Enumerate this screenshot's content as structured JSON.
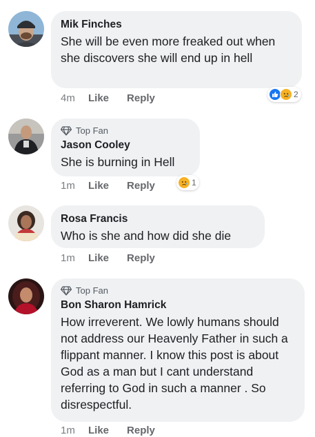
{
  "comments": [
    {
      "top_fan": "",
      "name": "Mik Finches",
      "text": "She will be even more freaked out when she discovers she will end up in hell",
      "time": "4m",
      "like": "Like",
      "reply": "Reply",
      "reaction_icons": [
        "like-reaction-icon",
        "sad-reaction-icon"
      ],
      "reaction_count": "2"
    },
    {
      "top_fan": "Top Fan",
      "name": "Jason Cooley",
      "text": "She is burning in Hell",
      "time": "1m",
      "like": "Like",
      "reply": "Reply",
      "reaction_icons": [
        "sad-reaction-icon"
      ],
      "reaction_count": "1"
    },
    {
      "top_fan": "",
      "name": "Rosa Francis",
      "text": "Who is she and how did she die",
      "time": "1m",
      "like": "Like",
      "reply": "Reply"
    },
    {
      "top_fan": "Top Fan",
      "name": "Bon Sharon Hamrick",
      "text": "How irreverent.  We lowly humans should not address our Heavenly Father in such a flippant manner. I know this post is about God as a man but I cant understand referring to God in such a manner . So disrespectful.",
      "time": "1m",
      "like": "Like",
      "reply": "Reply"
    }
  ],
  "colors": {
    "bubble": "#eff1f3",
    "meta_text": "#65676b",
    "like_blue": "#1877f2",
    "sad_yellow": "#f7b125"
  }
}
